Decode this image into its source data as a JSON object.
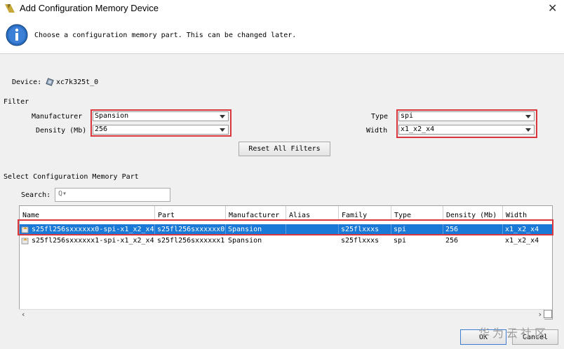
{
  "window": {
    "title": "Add Configuration Memory Device"
  },
  "header": {
    "info_text": "Choose a configuration memory part. This can be changed later."
  },
  "device": {
    "label": "Device:",
    "value": "xc7k325t_0"
  },
  "filter": {
    "section_label": "Filter",
    "manufacturer_label": "Manufacturer",
    "manufacturer_value": "Spansion",
    "density_label": "Density (Mb)",
    "density_value": "256",
    "type_label": "Type",
    "type_value": "spi",
    "width_label": "Width",
    "width_value": "x1_x2_x4",
    "reset_label": "Reset All Filters"
  },
  "select": {
    "section_label": "Select Configuration Memory Part",
    "search_label": "Search:",
    "search_placeholder": "Q▾"
  },
  "table": {
    "columns": [
      "Name",
      "Part",
      "Manufacturer",
      "Alias",
      "Family",
      "Type",
      "Density (Mb)",
      "Width"
    ],
    "rows": [
      [
        "s25fl256sxxxxxx0-spi-x1_x2_x4",
        "s25fl256sxxxxxx0",
        "Spansion",
        "",
        "s25flxxxs",
        "spi",
        "256",
        "x1_x2_x4"
      ],
      [
        "s25fl256sxxxxxx1-spi-x1_x2_x4",
        "s25fl256sxxxxxx1",
        "Spansion",
        "",
        "s25flxxxs",
        "spi",
        "256",
        "x1_x2_x4"
      ]
    ]
  },
  "buttons": {
    "ok_label": "OK",
    "cancel_label": "Cancel"
  },
  "watermark": "华为云社区",
  "colors": {
    "selection": "#1a79d6",
    "highlight_box": "#d9363e",
    "info_blue": "#1f5fb0"
  }
}
